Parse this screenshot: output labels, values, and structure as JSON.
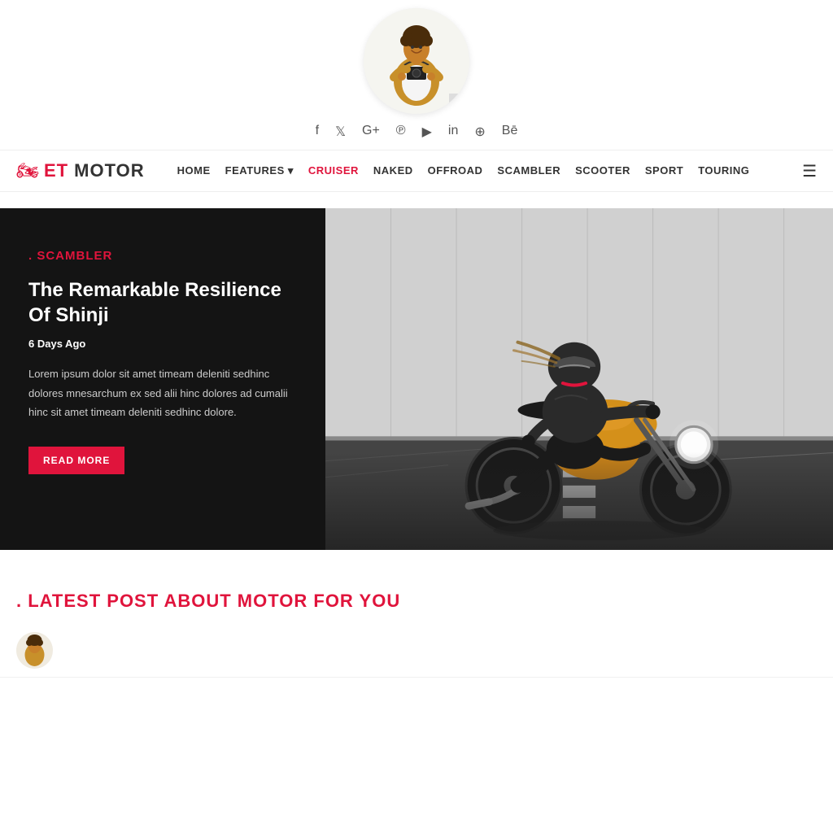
{
  "site": {
    "logo_et": "ET",
    "logo_motor": " MOTOR"
  },
  "social_icons": [
    {
      "name": "facebook",
      "symbol": "f"
    },
    {
      "name": "twitter",
      "symbol": "𝕏"
    },
    {
      "name": "google-plus",
      "symbol": "G+"
    },
    {
      "name": "pinterest",
      "symbol": "℗"
    },
    {
      "name": "youtube",
      "symbol": "▶"
    },
    {
      "name": "linkedin",
      "symbol": "in"
    },
    {
      "name": "dribbble",
      "symbol": "⊕"
    },
    {
      "name": "behance",
      "symbol": "Bē"
    }
  ],
  "nav": {
    "items": [
      {
        "label": "HOME",
        "active": false
      },
      {
        "label": "FEATURES",
        "active": false,
        "has_dropdown": true
      },
      {
        "label": "CRUISER",
        "active": true
      },
      {
        "label": "NAKED",
        "active": false
      },
      {
        "label": "OFFROAD",
        "active": false
      },
      {
        "label": "SCAMBLER",
        "active": false
      },
      {
        "label": "SCOOTER",
        "active": false
      },
      {
        "label": "SPORT",
        "active": false
      },
      {
        "label": "TOURING",
        "active": false
      }
    ]
  },
  "hero": {
    "category": "SCAMBLER",
    "title": "The Remarkable Resilience Of Shinji",
    "date": "6 Days Ago",
    "excerpt": "Lorem ipsum dolor sit amet timeam deleniti sedhinc dolores mnesarchum ex sed alii hinc dolores ad cumalii hinc sit amet timeam deleniti sedhinc dolore.",
    "read_more_label": "READ MORE"
  },
  "latest_section": {
    "heading": "LATEST POST ABOUT MOTOR FOR YOU"
  }
}
